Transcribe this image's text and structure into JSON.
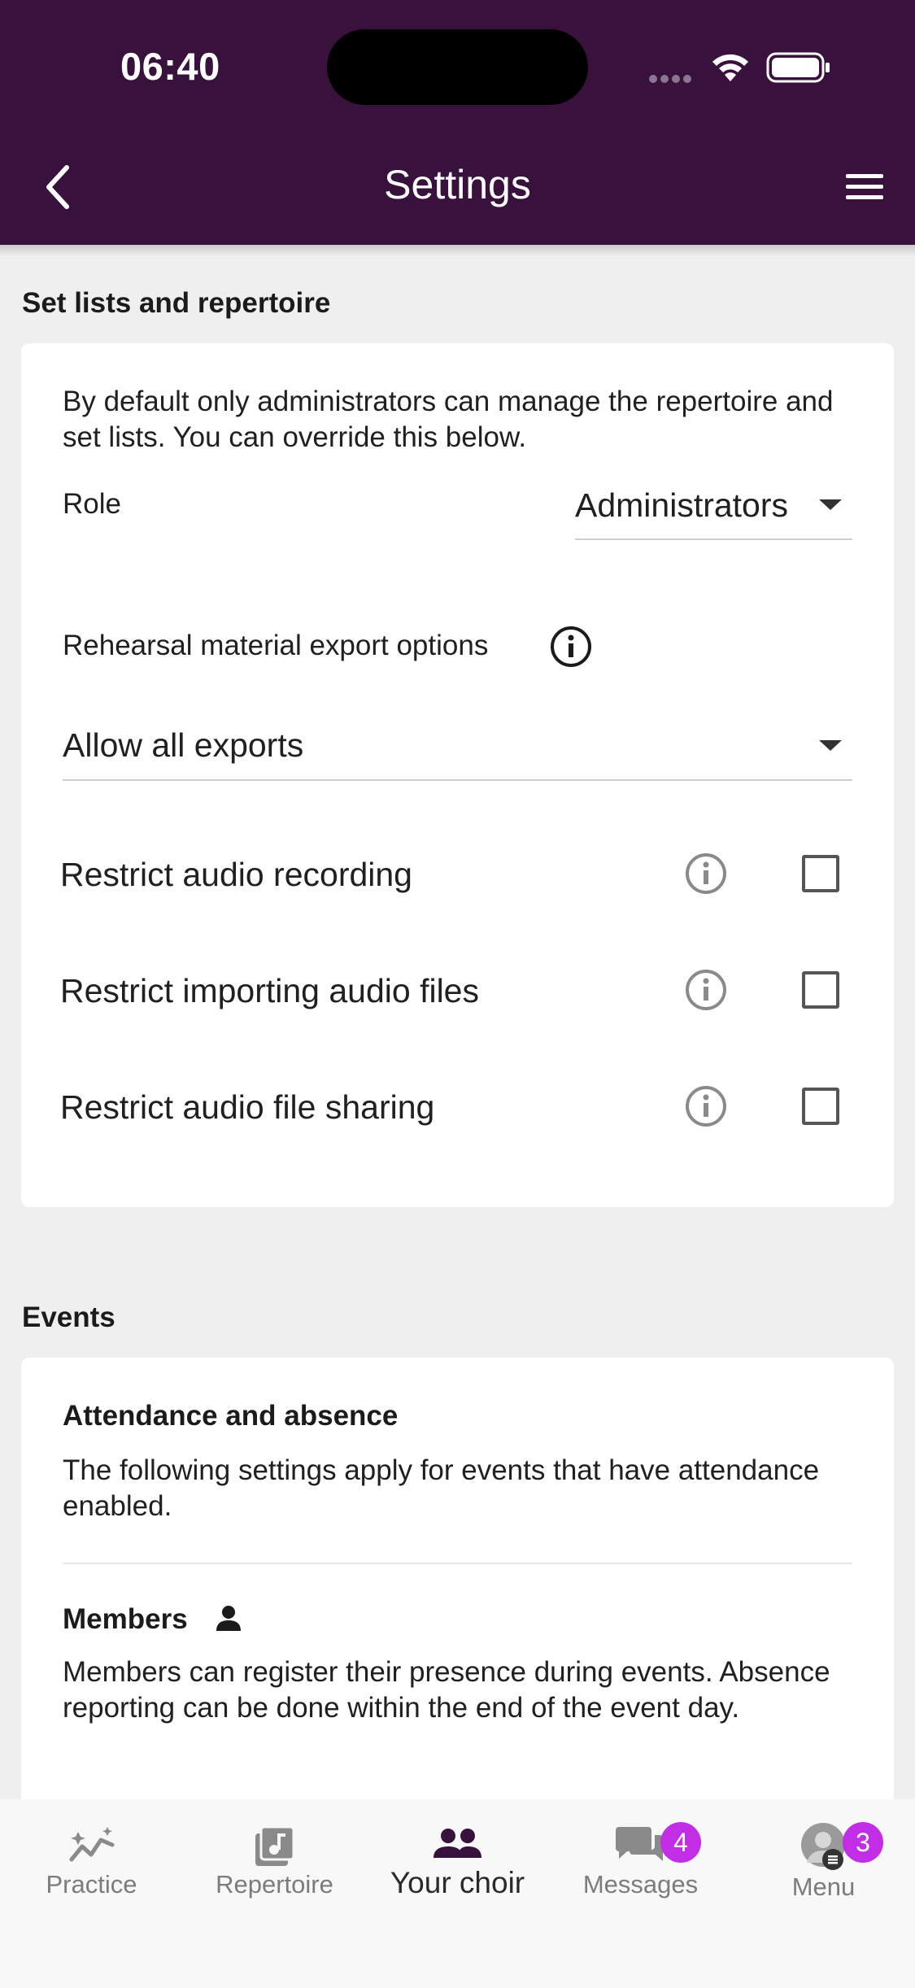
{
  "status_bar": {
    "time": "06:40"
  },
  "header": {
    "title": "Settings"
  },
  "setlists": {
    "section_title": "Set lists and repertoire",
    "description": "By default only administrators can manage the repertoire and set lists. You can override this below.",
    "role_label": "Role",
    "role_value": "Administrators",
    "export_label": "Rehearsal material export options",
    "export_value": "Allow all exports",
    "rows": [
      {
        "label": "Restrict audio recording",
        "checked": false
      },
      {
        "label": "Restrict importing audio files",
        "checked": false
      },
      {
        "label": "Restrict audio file sharing",
        "checked": false
      }
    ]
  },
  "events": {
    "section_title": "Events",
    "attendance_title": "Attendance and absence",
    "attendance_text": "The following settings apply for events that have attendance enabled.",
    "members_title": "Members",
    "members_text": "Members can register their presence during events. Absence reporting can be done within the end of the event day."
  },
  "bottom_nav": {
    "items": [
      {
        "label": "Practice",
        "icon": "chart-stars-icon"
      },
      {
        "label": "Repertoire",
        "icon": "music-note-icon"
      },
      {
        "label": "Your choir",
        "icon": "people-icon",
        "active": true
      },
      {
        "label": "Messages",
        "icon": "chat-bubbles-icon",
        "badge": "4"
      },
      {
        "label": "Menu",
        "icon": "avatar",
        "badge": "3"
      }
    ]
  },
  "colors": {
    "header_bg": "#38123c",
    "badge": "#c22ee6",
    "background": "#efefef"
  }
}
